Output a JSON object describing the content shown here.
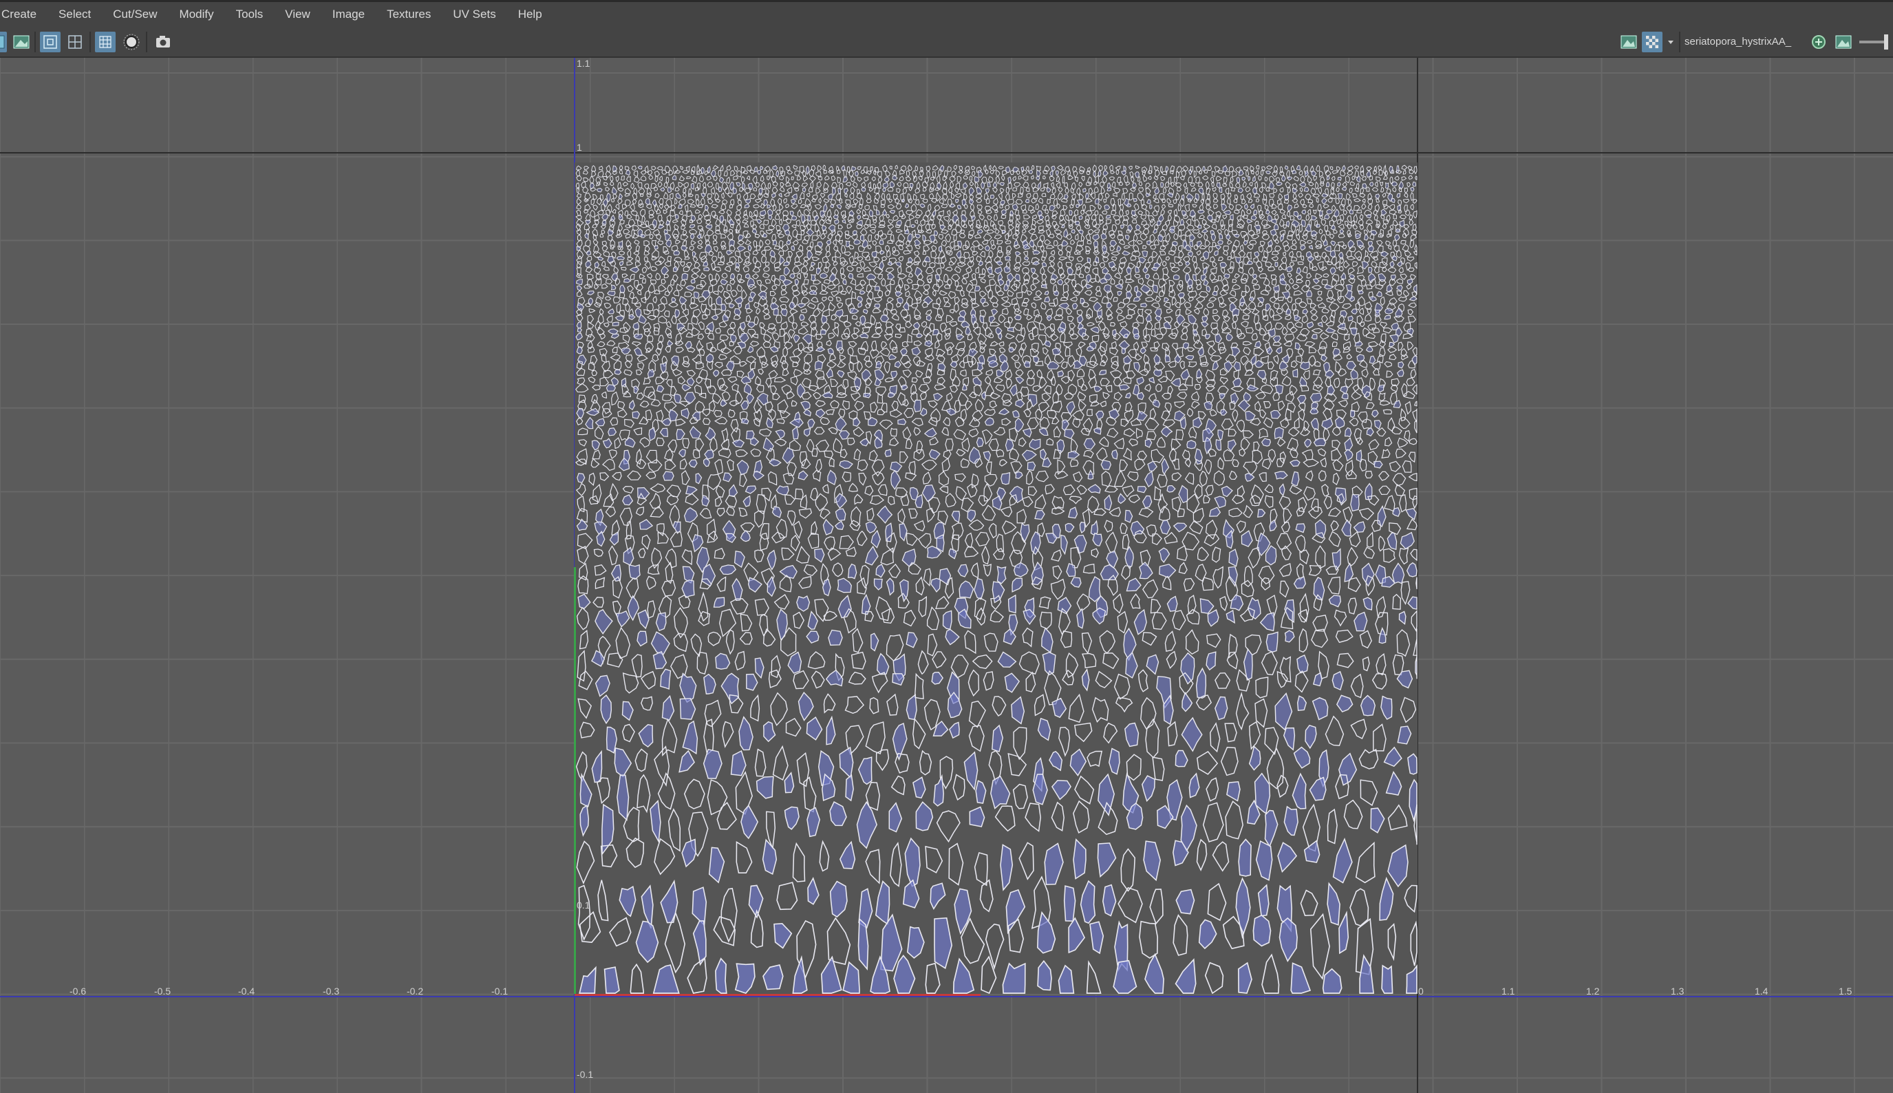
{
  "menubar": {
    "items": [
      "Create",
      "Select",
      "Cut/Sew",
      "Modify",
      "Tools",
      "View",
      "Image",
      "Textures",
      "UV Sets",
      "Help"
    ]
  },
  "toolbar": {
    "left_icons": [
      "uv-shell-icon",
      "image-toggle-icon",
      "grid-snap-icon",
      "wireframe-icon",
      "pixel-snap-icon",
      "shaded-icon",
      "snapshot-icon"
    ],
    "right_icons": [
      "display-image-icon",
      "checker-icon",
      "dropdown-arrow-icon",
      "uv-set-icon",
      "texture-icon"
    ],
    "uv_set_name": "seriatopora_hystrixAA_"
  },
  "viewport": {
    "u_axis_ticks": [
      "-0.6",
      "-0.5",
      "-0.4",
      "-0.3",
      "-0.2",
      "-0.1",
      "0",
      "1.1",
      "1.2",
      "1.3",
      "1.4",
      "1.5"
    ],
    "v_axis_ticks": [
      "1.1",
      "1",
      "0.1",
      "-0.1"
    ],
    "colors": {
      "background": "#5b5b5b",
      "grid": "#686868",
      "uv_wire": "#e8e8f0",
      "uv_fill": "#6f78c8",
      "axis_blue": "#3a3ab0",
      "axis_red": "#c63a3a",
      "axis_green": "#3aa34a"
    }
  }
}
